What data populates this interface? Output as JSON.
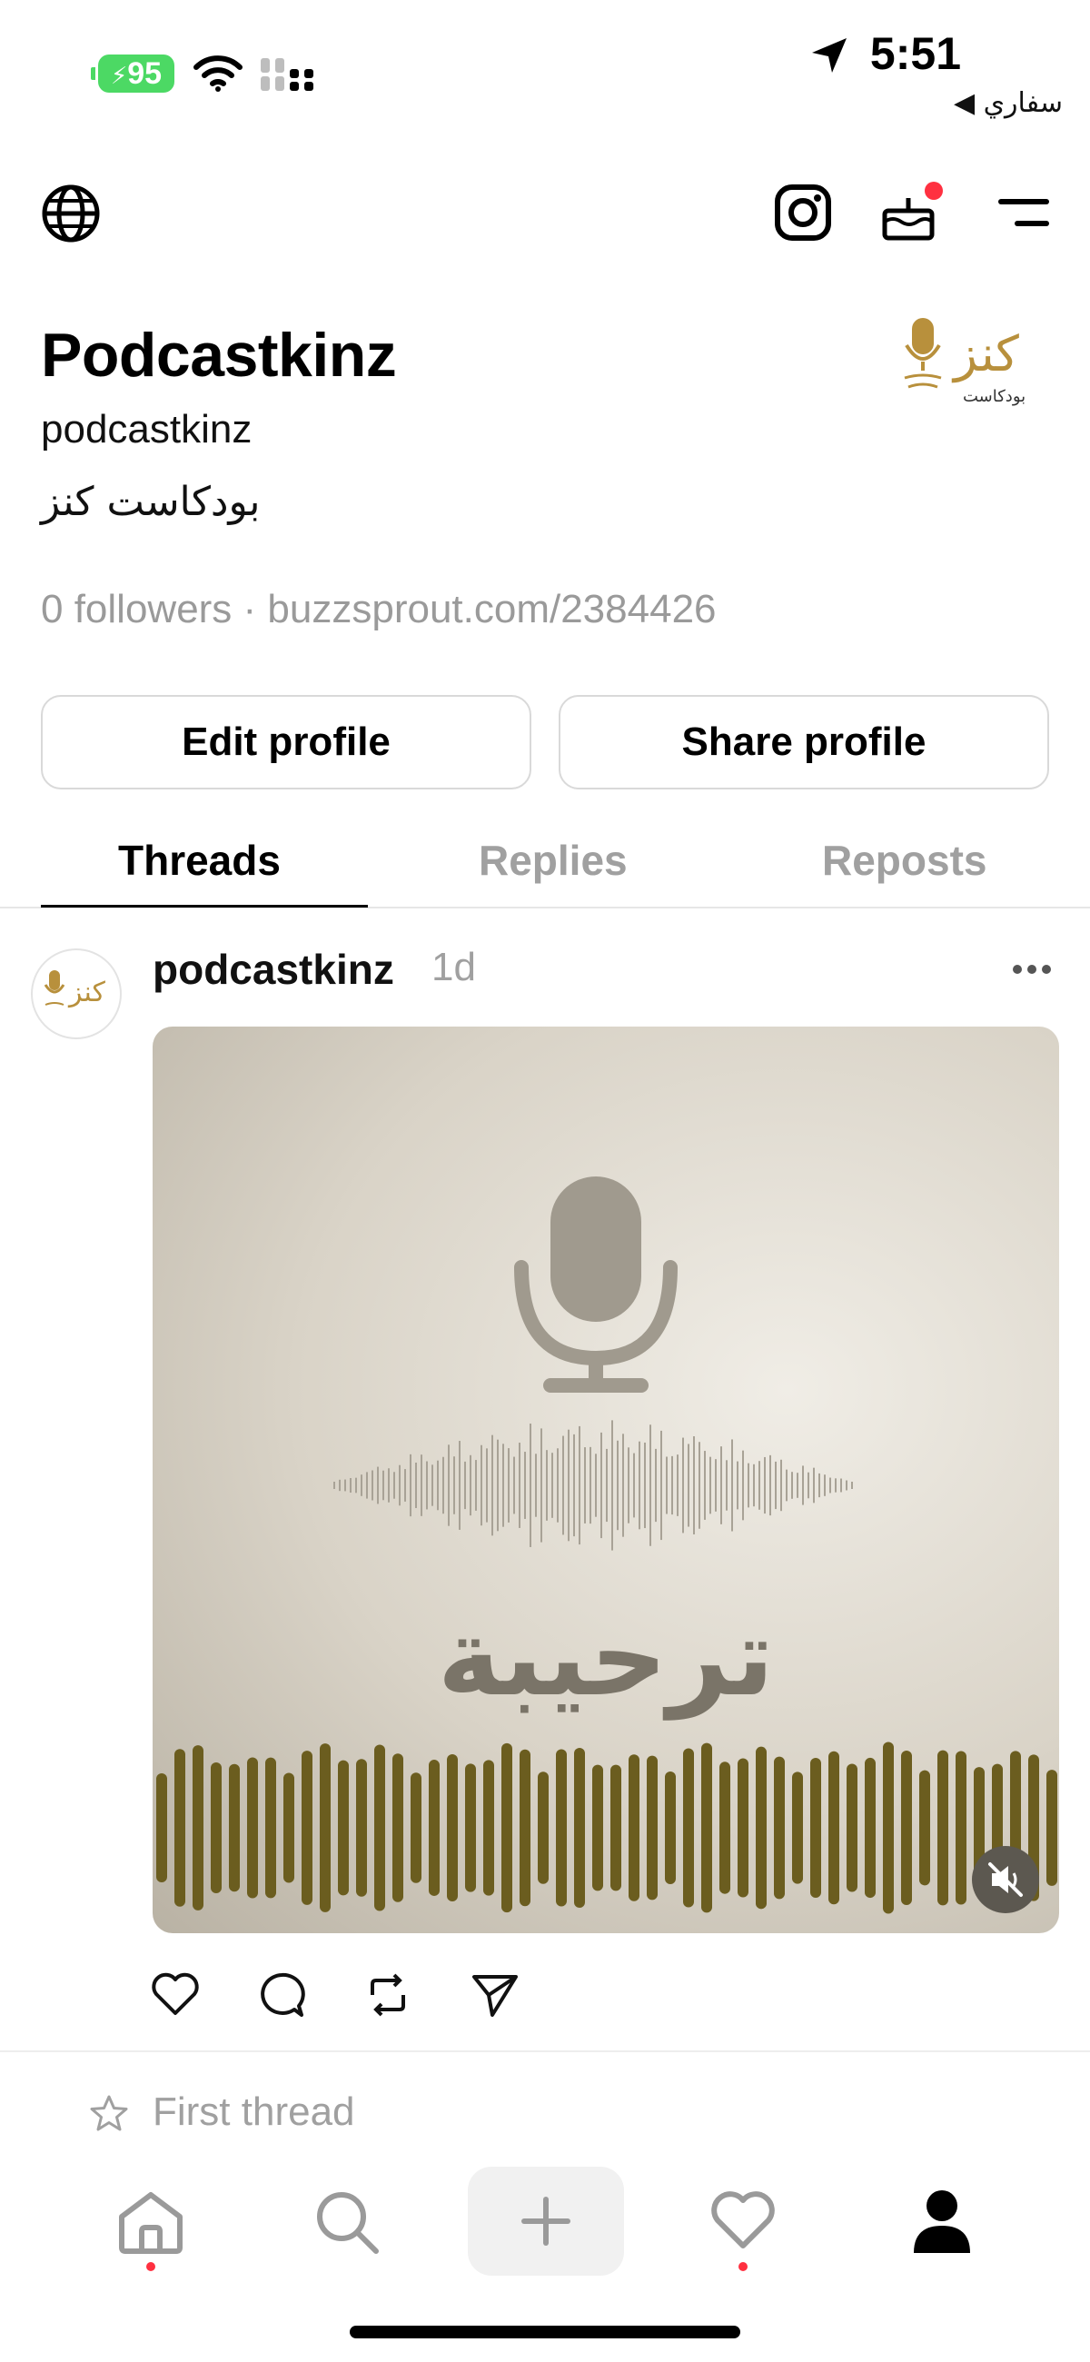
{
  "status_bar": {
    "battery": "95",
    "time": "5:51",
    "back_app": "◀ سفاري"
  },
  "header": {
    "globe_icon": "globe-icon",
    "instagram_icon": "instagram-icon",
    "birthday_icon": "birthday-cake-icon",
    "menu_icon": "menu-icon"
  },
  "profile": {
    "name": "Podcastkinz",
    "handle": "podcastkinz",
    "bio": "بودكاست كنز",
    "meta": "0 followers · buzzsprout.com/2384426",
    "edit_label": "Edit profile",
    "share_label": "Share profile",
    "logo_text": "كنز",
    "logo_sub": "بودكاست"
  },
  "tabs": [
    {
      "label": "Threads",
      "active": true
    },
    {
      "label": "Replies",
      "active": false
    },
    {
      "label": "Reposts",
      "active": false
    }
  ],
  "post": {
    "username": "podcastkinz",
    "time": "1d",
    "media_title": "ترحيبة",
    "media_muted": true
  },
  "first_thread_label": "First thread",
  "bottom_nav": [
    "home-icon",
    "search-icon",
    "plus-icon",
    "heart-icon",
    "profile-icon"
  ],
  "colors": {
    "accent_red": "#ff3040",
    "olive": "#6b5d1f",
    "muted_text": "#9a9a9a"
  }
}
